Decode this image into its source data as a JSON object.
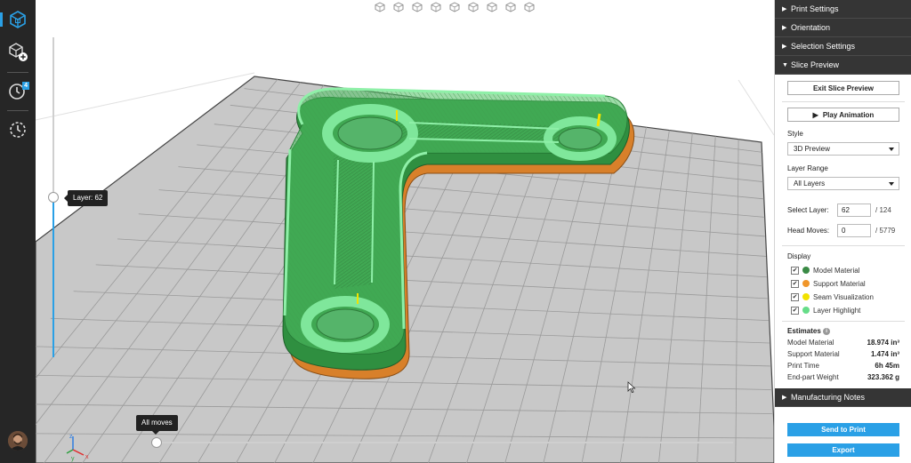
{
  "toolbar": {
    "items": [
      {
        "icon": "package-cube-icon",
        "active": true
      },
      {
        "icon": "add-part-icon"
      },
      {
        "icon": "clock-icon",
        "badge": "4"
      },
      {
        "icon": "history-icon"
      }
    ],
    "accent": "#2aa0e6"
  },
  "viewport": {
    "view_buttons": [
      "front-view-icon",
      "back-view-icon",
      "left-view-icon",
      "right-view-icon",
      "top-view-icon",
      "bottom-view-icon",
      "iso-view-icon",
      "perspective-icon",
      "zoom-fit-icon"
    ],
    "layer_slider": {
      "tooltip": "Layer: 62",
      "value": 62,
      "max": 124
    },
    "move_slider": {
      "tooltip": "All moves",
      "value": 0
    },
    "axes": {
      "x": "x",
      "y": "y",
      "z": "z"
    }
  },
  "panel": {
    "sections_top": [
      "Print Settings",
      "Orientation",
      "Selection Settings"
    ],
    "slice_preview": {
      "title": "Slice Preview",
      "exit_button": "Exit Slice Preview",
      "play_button": "Play Animation",
      "style_label": "Style",
      "style_value": "3D Preview",
      "layer_range_label": "Layer Range",
      "layer_range_value": "All Layers",
      "select_layer_label": "Select Layer:",
      "select_layer_value": "62",
      "select_layer_total": "/ 124",
      "head_moves_label": "Head Moves:",
      "head_moves_value": "0",
      "head_moves_total": "/ 5779",
      "display_label": "Display",
      "display_items": [
        {
          "label": "Model Material",
          "color": "#3a8a45",
          "checked": true
        },
        {
          "label": "Support Material",
          "color": "#f0962a",
          "checked": true
        },
        {
          "label": "Seam Visualization",
          "color": "#f2e200",
          "checked": true
        },
        {
          "label": "Layer Highlight",
          "color": "#66dd88",
          "checked": true
        }
      ],
      "estimates_label": "Estimates",
      "estimates": [
        {
          "label": "Model Material",
          "value": "18.974 in³"
        },
        {
          "label": "Support Material",
          "value": "1.474 in³"
        },
        {
          "label": "Print Time",
          "value": "6h 45m"
        },
        {
          "label": "End-part Weight",
          "value": "323.362 g"
        }
      ]
    },
    "manufacturing_notes": "Manufacturing Notes",
    "send_button": "Send to Print",
    "export_button": "Export"
  }
}
